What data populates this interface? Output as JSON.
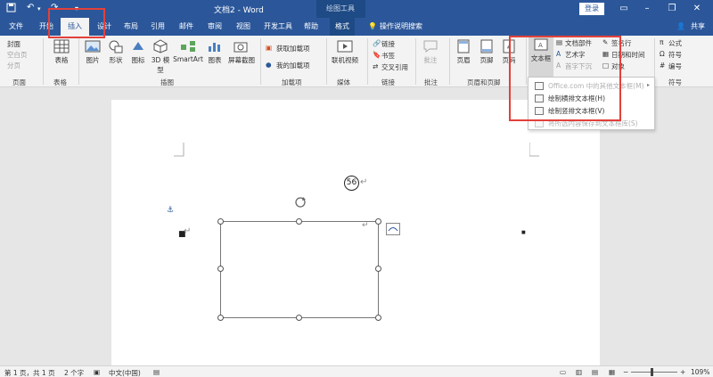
{
  "titlebar": {
    "doc_title": "文档2 - Word",
    "context_title": "绘图工具",
    "login_label": "登录",
    "qa_save_icon": "save-icon",
    "qa_undo_icon": "undo-icon",
    "window_controls": [
      "minimize-icon",
      "restore-icon",
      "maximize-icon",
      "close-icon"
    ]
  },
  "tabs": [
    {
      "label": "文件"
    },
    {
      "label": "开始"
    },
    {
      "label": "插入"
    },
    {
      "label": "设计"
    },
    {
      "label": "布局"
    },
    {
      "label": "引用"
    },
    {
      "label": "邮件"
    },
    {
      "label": "审阅"
    },
    {
      "label": "视图"
    },
    {
      "label": "开发工具"
    },
    {
      "label": "帮助"
    },
    {
      "label": "格式"
    },
    {
      "label": "操作说明搜索"
    },
    {
      "label": "共享"
    }
  ],
  "ribbon": {
    "page_group": {
      "label": "页面",
      "items": [
        "封面",
        "空白页",
        "分页"
      ]
    },
    "table_group": {
      "label": "表格",
      "button": "表格"
    },
    "illus_group": {
      "label": "插图",
      "buttons": [
        "图片",
        "形状",
        "图标",
        "3D 模型",
        "SmartArt",
        "图表",
        "屏幕截图"
      ]
    },
    "addins_group": {
      "label": "加载项",
      "items": [
        "获取加载项",
        "我的加载项"
      ]
    },
    "media_group": {
      "label": "媒体",
      "button": "联机视频"
    },
    "links_group": {
      "label": "链接",
      "items": [
        "链接",
        "书签",
        "交叉引用"
      ]
    },
    "comment_group": {
      "label": "批注",
      "button": "批注"
    },
    "hf_group": {
      "label": "页眉和页脚",
      "buttons": [
        "页眉",
        "页脚",
        "页码"
      ]
    },
    "text_group": {
      "label": "文本",
      "textbox": "文本框",
      "items": [
        "文档部件",
        "艺术字",
        "首字下沉",
        "签名行",
        "日期和时间",
        "对象"
      ]
    },
    "symbol_group": {
      "label": "符号",
      "items": [
        "公式",
        "符号",
        "编号"
      ]
    }
  },
  "dropdown": {
    "items": [
      {
        "label": "Office.com 中的其他文本框(M)",
        "disabled": true
      },
      {
        "label": "绘制横排文本框(H)",
        "disabled": false
      },
      {
        "label": "绘制竖排文本框(V)",
        "disabled": false
      },
      {
        "label": "将所选内容保存到文本框库(S)",
        "disabled": true
      }
    ]
  },
  "document": {
    "circle_text": "56",
    "para_mark": "↵"
  },
  "status": {
    "page": "第 1 页，共 1 页",
    "words": "2 个字",
    "lang": "中文(中国)",
    "zoom": "109%"
  },
  "colors": {
    "accent": "#2b579a",
    "highlight": "#e3403a"
  }
}
